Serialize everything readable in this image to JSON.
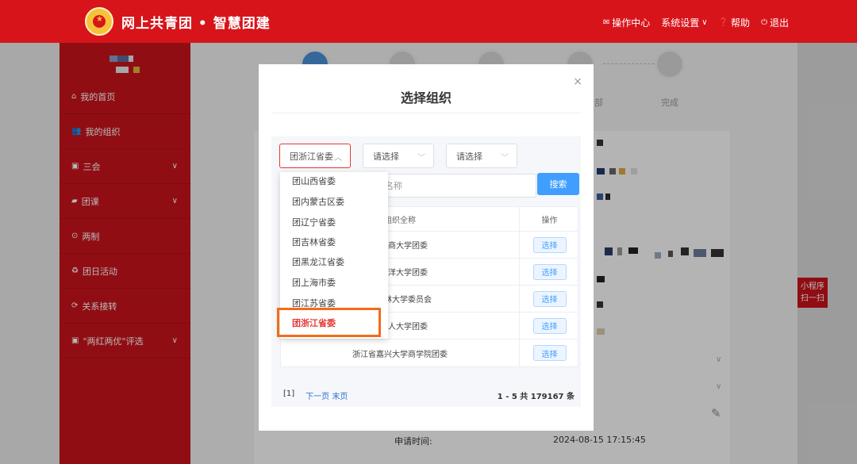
{
  "header": {
    "title": "网上共青团 • 智慧团建",
    "nav": [
      {
        "icon": "envelope-icon",
        "label": "操作中心"
      },
      {
        "icon": "",
        "label": "系统设置"
      },
      {
        "icon": "question-icon",
        "label": "帮助"
      },
      {
        "icon": "power-icon",
        "label": "退出"
      }
    ]
  },
  "sidebar": {
    "items": [
      {
        "icon": "home-icon",
        "label": "我的首页",
        "expandable": false
      },
      {
        "icon": "users-icon",
        "label": "我的组织",
        "expandable": false
      },
      {
        "icon": "edit-icon",
        "label": "三会",
        "expandable": true
      },
      {
        "icon": "folder-icon",
        "label": "团课",
        "expandable": true
      },
      {
        "icon": "circle-icon",
        "label": "两制",
        "expandable": false
      },
      {
        "icon": "recycle-icon",
        "label": "团日活动",
        "expandable": false
      },
      {
        "icon": "refresh-icon",
        "label": "关系接转",
        "expandable": false
      },
      {
        "icon": "edit-icon",
        "label": "\"两红两优\"评选",
        "expandable": true
      }
    ]
  },
  "background": {
    "steps": [
      "部",
      "完成"
    ],
    "apply_time_label": "申请时间:",
    "apply_time_value": "2024-08-15 17:15:45",
    "mini_program": [
      "小程序",
      "扫一扫"
    ]
  },
  "modal": {
    "title": "选择组织",
    "close": "×",
    "selects": [
      {
        "value": "团浙江省委",
        "arrow": "︿"
      },
      {
        "value": "请选择",
        "arrow": "﹀"
      },
      {
        "value": "请选择",
        "arrow": "﹀"
      }
    ],
    "name_placeholder": "名称",
    "search_label": "搜索",
    "table": {
      "headers": [
        "组织全称",
        "操作"
      ],
      "rows": [
        {
          "name": "江工商大学团委",
          "action": "选择"
        },
        {
          "name": "江海洋大学团委",
          "action": "选择"
        },
        {
          "name": "江农林大学委员会",
          "action": "选择"
        },
        {
          "name": "江树人大学团委",
          "action": "选择"
        },
        {
          "name": "浙江省嘉兴大学商学院团委",
          "action": "选择"
        }
      ]
    },
    "pager": {
      "current": "[1]",
      "next": "下一页",
      "last": "末页",
      "info": "1 - 5  共 179167 条"
    }
  },
  "dropdown": {
    "items": [
      "团山西省委",
      "团内蒙古区委",
      "团辽宁省委",
      "团吉林省委",
      "团黑龙江省委",
      "团上海市委",
      "团江苏省委",
      "团浙江省委"
    ],
    "selected_index": 7
  },
  "colors": {
    "brand_red": "#d8141b",
    "primary_blue": "#409eff",
    "highlight_orange": "#f26c1a"
  }
}
